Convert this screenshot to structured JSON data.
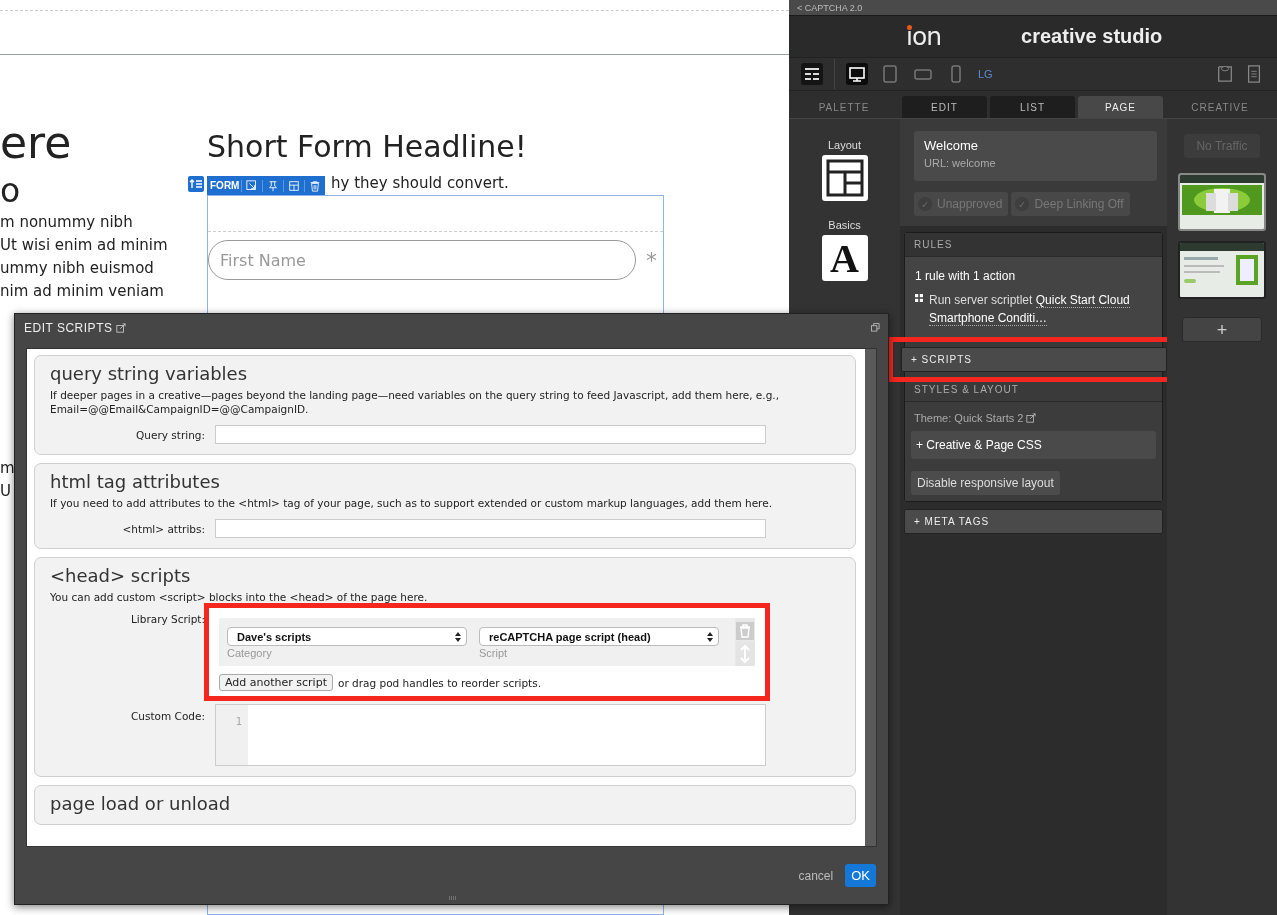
{
  "canvas": {
    "left_heading": "ere",
    "left_subheading": "o",
    "left_lines": [
      "m nonummy nibh",
      "Ut wisi enim ad minim",
      "ummy nibh euismod",
      "nim ad minim veniam"
    ],
    "left_fragments": [
      "m",
      "U"
    ],
    "headline": "Short Form Headline!",
    "subtitle": "hy they should convert.",
    "form_toolbar": {
      "label": "FORM"
    },
    "fields": [
      {
        "placeholder": "First Name",
        "required": true,
        "required_mark": "*"
      }
    ]
  },
  "studio": {
    "back_link": "< CAPTCHA 2.0",
    "logo": "ion",
    "title": "creative studio",
    "device_label": "LG",
    "devices": [
      {
        "kind": "desktop",
        "selected": true
      },
      {
        "kind": "tablet",
        "selected": false
      },
      {
        "kind": "landscape",
        "selected": false
      },
      {
        "kind": "phone",
        "selected": false
      }
    ],
    "tabs": [
      {
        "label": "PALETTE",
        "selected": false,
        "kind": "plain"
      },
      {
        "label": "EDIT",
        "selected": false,
        "kind": "box"
      },
      {
        "label": "LIST",
        "selected": false,
        "kind": "box"
      },
      {
        "label": "PAGE",
        "selected": true,
        "kind": "box"
      },
      {
        "label": "CREATIVE",
        "selected": false,
        "kind": "plain"
      }
    ],
    "palette": [
      {
        "label": "Layout",
        "kind": "layout"
      },
      {
        "label": "Basics",
        "kind": "letter",
        "glyph": "A"
      }
    ],
    "page": {
      "name": "Welcome",
      "url": "URL: welcome",
      "badges": [
        {
          "label": "Unapproved",
          "checked": false,
          "check_glyph": "✓"
        },
        {
          "label": "Deep Linking Off",
          "checked": false,
          "check_glyph": "✓"
        }
      ],
      "rules": {
        "heading": "RULES",
        "summary": "1 rule with 1 action",
        "action_prefix": "Run server scriptlet",
        "action_link": "Quick Start Cloud Smartphone Conditi…"
      },
      "scripts": {
        "label": "+ SCRIPTS",
        "highlighted": true
      },
      "styles": {
        "heading": "STYLES & LAYOUT",
        "theme": "Theme: Quick Starts 2",
        "css_button": "+ Creative & Page CSS",
        "responsive_button": "Disable responsive layout"
      },
      "meta_tags": "+ META TAGS"
    },
    "creative": {
      "traffic": "No Traffic",
      "pages": [
        {
          "kind": "picture",
          "selected": true
        },
        {
          "kind": "picture",
          "selected": false
        }
      ],
      "add_button": "+"
    }
  },
  "modal": {
    "title": "EDIT SCRIPTS",
    "sections": [
      {
        "kind": "fields",
        "title": "query string variables",
        "description": "If deeper pages in a creative—pages beyond the landing page—need variables on the query string to feed Javascript, add them here, e.g., Email=@@Email&CampaignID=@@CampaignID.",
        "fields": [
          {
            "label": "Query string:"
          }
        ]
      },
      {
        "kind": "fields",
        "title": "html tag attributes",
        "description": "If you need to add attributes to the <html> tag of your page, such as to support extended or custom markup languages, add them here.",
        "fields": [
          {
            "label": "<html> attribs:"
          }
        ]
      },
      {
        "kind": "scripts",
        "title": "<head> scripts",
        "description": "You can add custom <script> blocks into the <head> of the page here.",
        "library": {
          "label": "Library Script:",
          "highlighted": true,
          "category": "Dave's scripts",
          "category_caption": "Category",
          "script": "reCAPTCHA page script (head)",
          "script_caption": "Script",
          "add_button": "Add another script",
          "hint": "or drag pod handles to reorder scripts."
        },
        "custom_code": {
          "label": "Custom Code:",
          "line_number": "1"
        }
      },
      {
        "kind": "title",
        "title": "page load or unload"
      }
    ],
    "cancel": "cancel",
    "ok": "OK"
  }
}
